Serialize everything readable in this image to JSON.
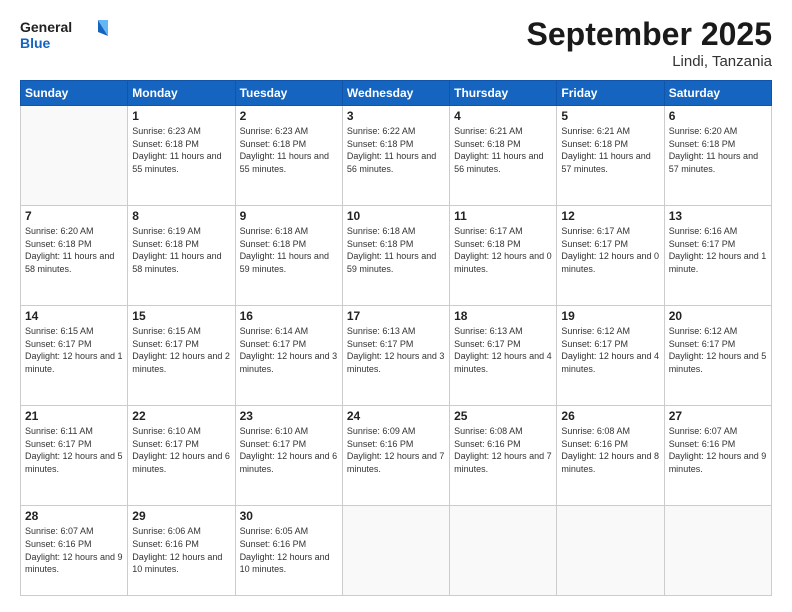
{
  "header": {
    "logo_general": "General",
    "logo_blue": "Blue",
    "month": "September 2025",
    "location": "Lindi, Tanzania"
  },
  "weekdays": [
    "Sunday",
    "Monday",
    "Tuesday",
    "Wednesday",
    "Thursday",
    "Friday",
    "Saturday"
  ],
  "weeks": [
    [
      {
        "day": "",
        "info": ""
      },
      {
        "day": "1",
        "info": "Sunrise: 6:23 AM\nSunset: 6:18 PM\nDaylight: 11 hours\nand 55 minutes."
      },
      {
        "day": "2",
        "info": "Sunrise: 6:23 AM\nSunset: 6:18 PM\nDaylight: 11 hours\nand 55 minutes."
      },
      {
        "day": "3",
        "info": "Sunrise: 6:22 AM\nSunset: 6:18 PM\nDaylight: 11 hours\nand 56 minutes."
      },
      {
        "day": "4",
        "info": "Sunrise: 6:21 AM\nSunset: 6:18 PM\nDaylight: 11 hours\nand 56 minutes."
      },
      {
        "day": "5",
        "info": "Sunrise: 6:21 AM\nSunset: 6:18 PM\nDaylight: 11 hours\nand 57 minutes."
      },
      {
        "day": "6",
        "info": "Sunrise: 6:20 AM\nSunset: 6:18 PM\nDaylight: 11 hours\nand 57 minutes."
      }
    ],
    [
      {
        "day": "7",
        "info": "Sunrise: 6:20 AM\nSunset: 6:18 PM\nDaylight: 11 hours\nand 58 minutes."
      },
      {
        "day": "8",
        "info": "Sunrise: 6:19 AM\nSunset: 6:18 PM\nDaylight: 11 hours\nand 58 minutes."
      },
      {
        "day": "9",
        "info": "Sunrise: 6:18 AM\nSunset: 6:18 PM\nDaylight: 11 hours\nand 59 minutes."
      },
      {
        "day": "10",
        "info": "Sunrise: 6:18 AM\nSunset: 6:18 PM\nDaylight: 11 hours\nand 59 minutes."
      },
      {
        "day": "11",
        "info": "Sunrise: 6:17 AM\nSunset: 6:18 PM\nDaylight: 12 hours\nand 0 minutes."
      },
      {
        "day": "12",
        "info": "Sunrise: 6:17 AM\nSunset: 6:17 PM\nDaylight: 12 hours\nand 0 minutes."
      },
      {
        "day": "13",
        "info": "Sunrise: 6:16 AM\nSunset: 6:17 PM\nDaylight: 12 hours\nand 1 minute."
      }
    ],
    [
      {
        "day": "14",
        "info": "Sunrise: 6:15 AM\nSunset: 6:17 PM\nDaylight: 12 hours\nand 1 minute."
      },
      {
        "day": "15",
        "info": "Sunrise: 6:15 AM\nSunset: 6:17 PM\nDaylight: 12 hours\nand 2 minutes."
      },
      {
        "day": "16",
        "info": "Sunrise: 6:14 AM\nSunset: 6:17 PM\nDaylight: 12 hours\nand 3 minutes."
      },
      {
        "day": "17",
        "info": "Sunrise: 6:13 AM\nSunset: 6:17 PM\nDaylight: 12 hours\nand 3 minutes."
      },
      {
        "day": "18",
        "info": "Sunrise: 6:13 AM\nSunset: 6:17 PM\nDaylight: 12 hours\nand 4 minutes."
      },
      {
        "day": "19",
        "info": "Sunrise: 6:12 AM\nSunset: 6:17 PM\nDaylight: 12 hours\nand 4 minutes."
      },
      {
        "day": "20",
        "info": "Sunrise: 6:12 AM\nSunset: 6:17 PM\nDaylight: 12 hours\nand 5 minutes."
      }
    ],
    [
      {
        "day": "21",
        "info": "Sunrise: 6:11 AM\nSunset: 6:17 PM\nDaylight: 12 hours\nand 5 minutes."
      },
      {
        "day": "22",
        "info": "Sunrise: 6:10 AM\nSunset: 6:17 PM\nDaylight: 12 hours\nand 6 minutes."
      },
      {
        "day": "23",
        "info": "Sunrise: 6:10 AM\nSunset: 6:17 PM\nDaylight: 12 hours\nand 6 minutes."
      },
      {
        "day": "24",
        "info": "Sunrise: 6:09 AM\nSunset: 6:16 PM\nDaylight: 12 hours\nand 7 minutes."
      },
      {
        "day": "25",
        "info": "Sunrise: 6:08 AM\nSunset: 6:16 PM\nDaylight: 12 hours\nand 7 minutes."
      },
      {
        "day": "26",
        "info": "Sunrise: 6:08 AM\nSunset: 6:16 PM\nDaylight: 12 hours\nand 8 minutes."
      },
      {
        "day": "27",
        "info": "Sunrise: 6:07 AM\nSunset: 6:16 PM\nDaylight: 12 hours\nand 9 minutes."
      }
    ],
    [
      {
        "day": "28",
        "info": "Sunrise: 6:07 AM\nSunset: 6:16 PM\nDaylight: 12 hours\nand 9 minutes."
      },
      {
        "day": "29",
        "info": "Sunrise: 6:06 AM\nSunset: 6:16 PM\nDaylight: 12 hours\nand 10 minutes."
      },
      {
        "day": "30",
        "info": "Sunrise: 6:05 AM\nSunset: 6:16 PM\nDaylight: 12 hours\nand 10 minutes."
      },
      {
        "day": "",
        "info": ""
      },
      {
        "day": "",
        "info": ""
      },
      {
        "day": "",
        "info": ""
      },
      {
        "day": "",
        "info": ""
      }
    ]
  ]
}
